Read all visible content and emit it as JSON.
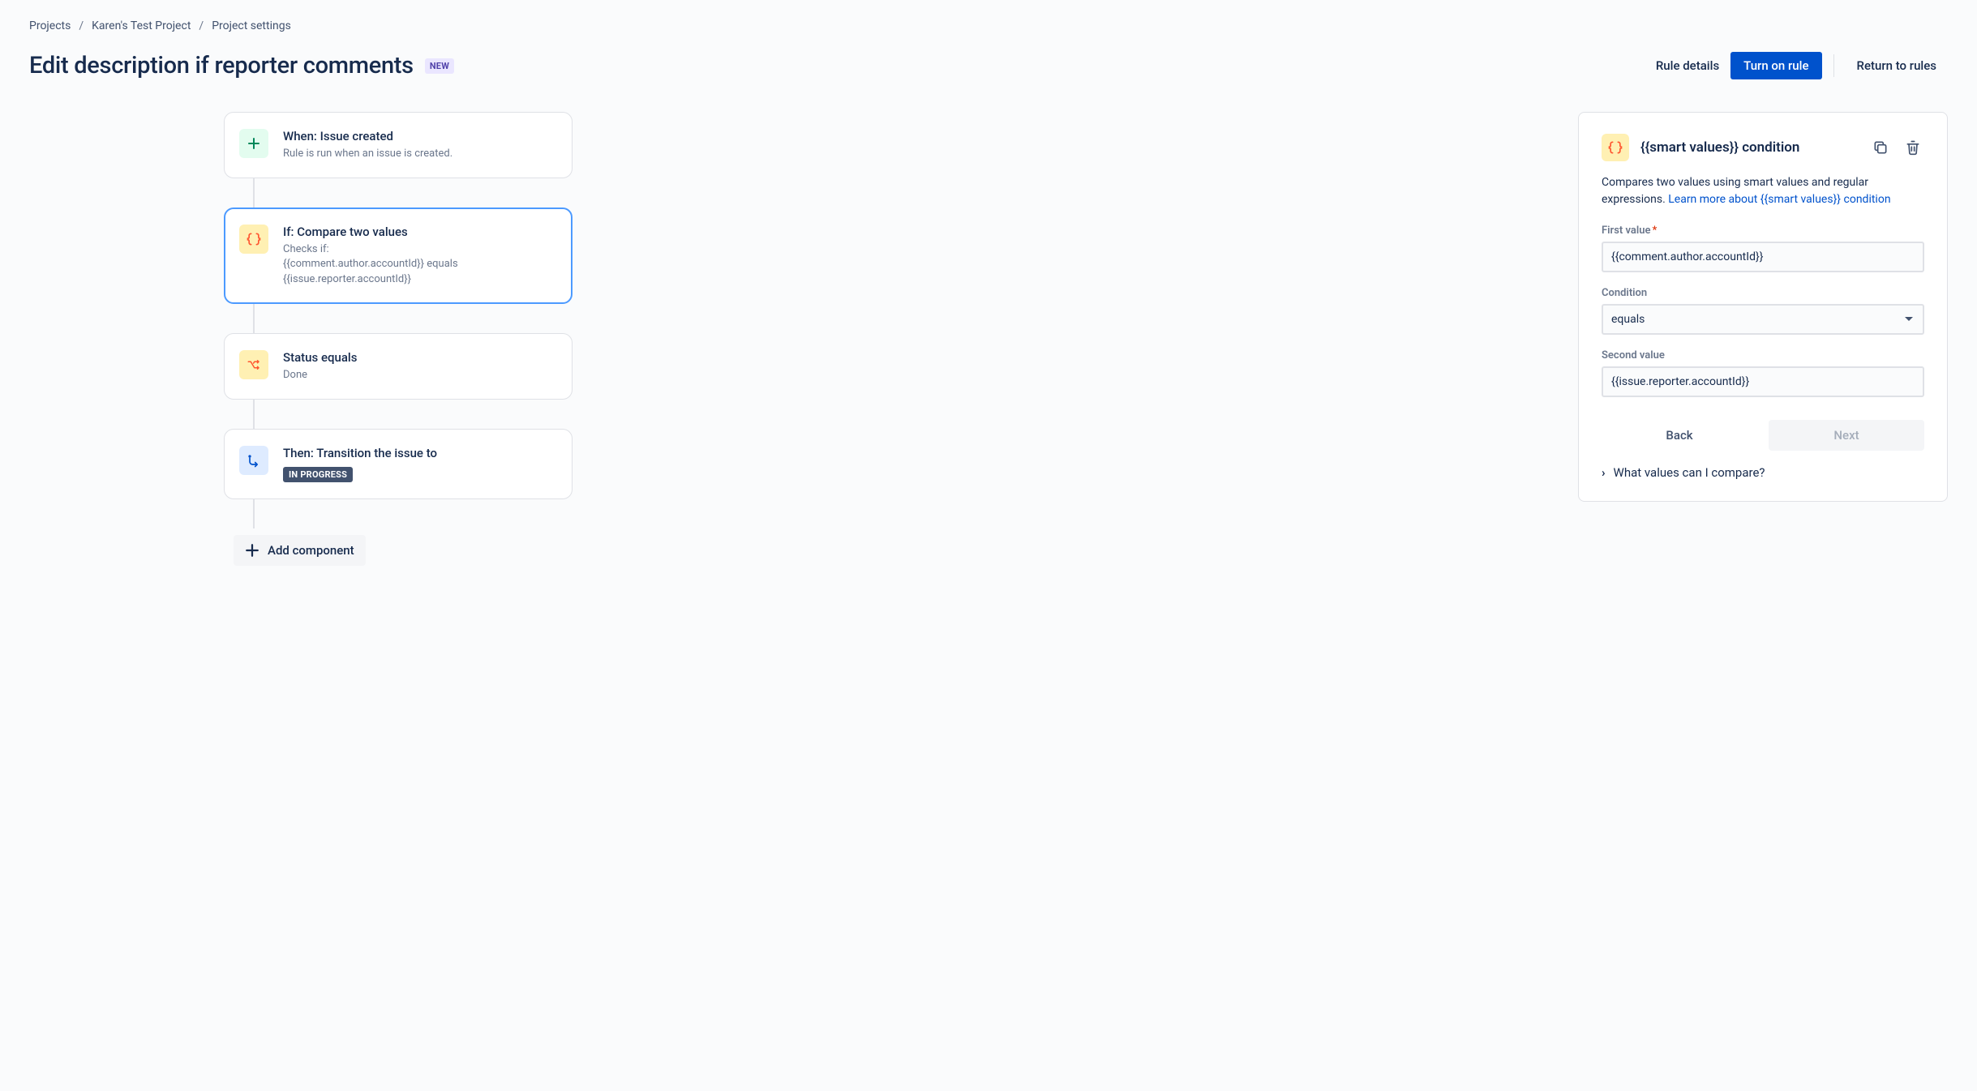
{
  "breadcrumb": {
    "item1": "Projects",
    "item2": "Karen's Test Project",
    "item3": "Project settings"
  },
  "header": {
    "title": "Edit description if reporter comments",
    "badge": "NEW",
    "rule_details": "Rule details",
    "turn_on": "Turn on rule",
    "return": "Return to rules"
  },
  "nodes": {
    "trigger": {
      "title": "When: Issue created",
      "sub": "Rule is run when an issue is created."
    },
    "compare": {
      "title": "If: Compare two values",
      "sub_prefix": "Checks if:",
      "line1": "{{comment.author.accountId}} equals",
      "line2": "{{issue.reporter.accountId}}"
    },
    "status": {
      "title": "Status equals",
      "sub": "Done"
    },
    "transition": {
      "title": "Then: Transition the issue to",
      "badge": "IN PROGRESS"
    }
  },
  "add_component": "Add component",
  "panel": {
    "title": "{{smart values}} condition",
    "desc": "Compares two values using smart values and regular expressions. ",
    "link": "Learn more about {{smart values}} condition",
    "first_value_label": "First value",
    "first_value": "{{comment.author.accountId}}",
    "condition_label": "Condition",
    "condition_value": "equals",
    "second_value_label": "Second value",
    "second_value": "{{issue.reporter.accountId}}",
    "back": "Back",
    "next": "Next",
    "disclosure": "What values can I compare?"
  }
}
